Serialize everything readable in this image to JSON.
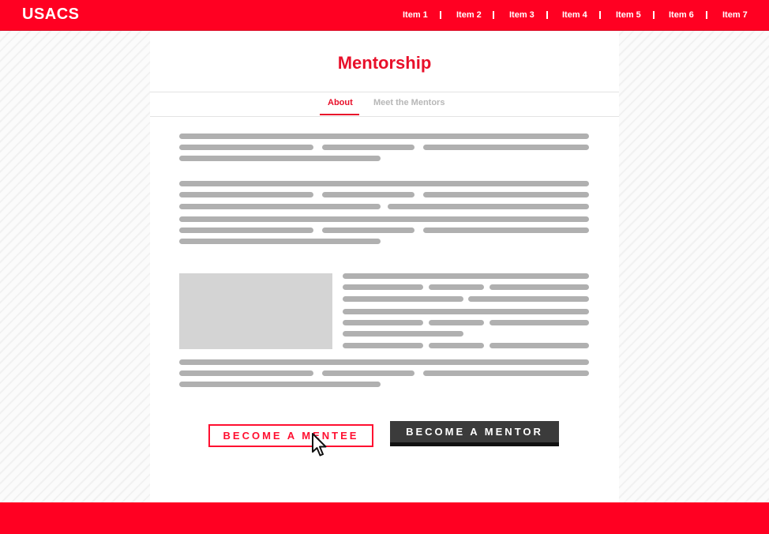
{
  "header": {
    "logo": "USACS",
    "nav": [
      "Item 1",
      "Item 2",
      "Item 3",
      "Item 4",
      "Item 5",
      "Item 6",
      "Item 7"
    ]
  },
  "page": {
    "title": "Mentorship",
    "tabs": [
      {
        "label": "About",
        "active": true
      },
      {
        "label": "Meet the Mentors",
        "active": false
      }
    ]
  },
  "actions": {
    "mentee_label": "BECOME A MENTEE",
    "mentor_label": "BECOME A MENTOR"
  },
  "colors": {
    "brand_red": "#ff0022",
    "text_red": "#e8102a",
    "placeholder_gray": "#b0b0b0",
    "dark_button": "#3b3b3b"
  },
  "icons": {
    "cursor": "mouse-pointer-icon"
  }
}
